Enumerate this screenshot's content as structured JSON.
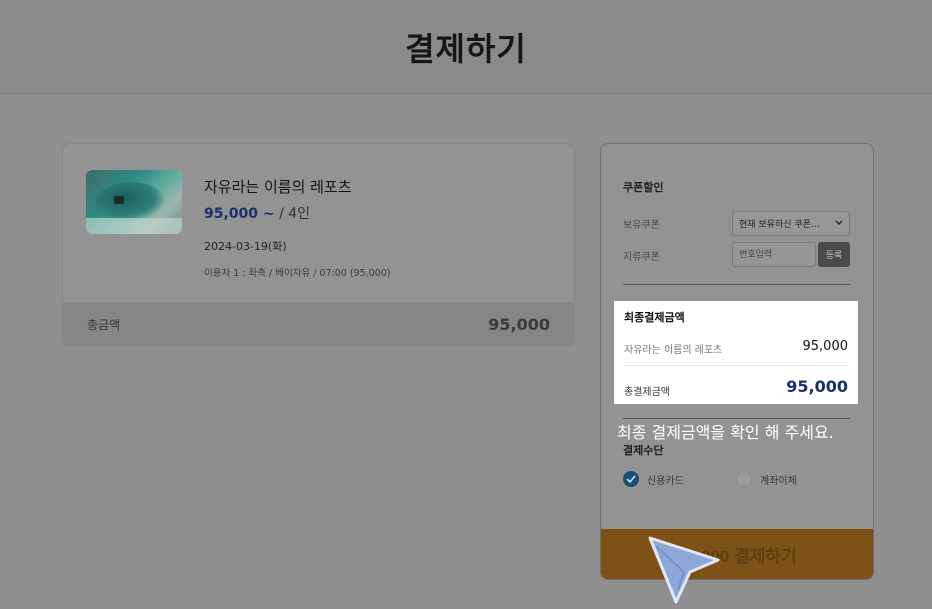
{
  "header": {
    "title": "결제하기"
  },
  "product": {
    "title": "자유라는 이름의 레포츠",
    "price": "95,000 ~",
    "per": " / 4인",
    "date": "2024-03-19(화)",
    "detail": "이용자 1 : 좌측 / 베이자유 / 07:00 (95,000)",
    "total_label": "총금액",
    "total_value": "95,000"
  },
  "coupon": {
    "section_title": "쿠폰할인",
    "owned_label": "보유쿠폰",
    "owned_select": "현재 보유하신 쿠폰…",
    "paper_label": "지류쿠폰",
    "input_placeholder": "번호입력",
    "register_label": "등록"
  },
  "final": {
    "title": "최종결제금액",
    "item_name": "자유라는 이름의 레포츠",
    "item_value": "95,000",
    "total_label": "총결제금액",
    "total_value": "95,000"
  },
  "tooltip": "최종 결제금액을 확인 해 주세요.",
  "method": {
    "title": "결제수단",
    "options": [
      {
        "label": "신용카드",
        "selected": true
      },
      {
        "label": "계좌이체",
        "selected": false
      }
    ]
  },
  "pay_button": {
    "label": "95,000 결제하기"
  },
  "colors": {
    "accent_price": "#1a2f70",
    "pay_button": "#7e5216",
    "radio_selected": "#1a4f75"
  }
}
